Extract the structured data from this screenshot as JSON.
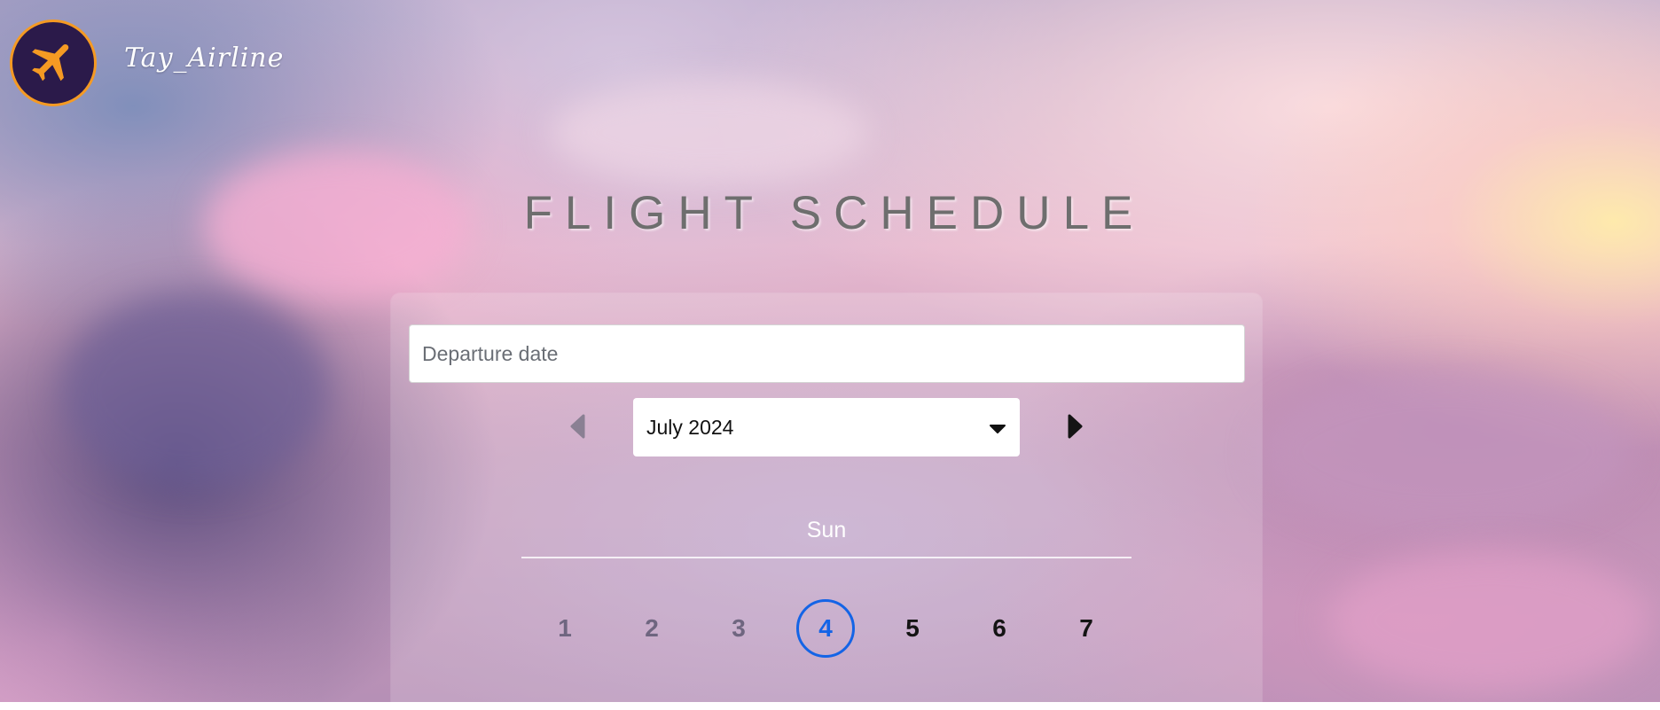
{
  "brand": {
    "name": "Tay_Airline",
    "logo_icon": "airplane-icon",
    "logo_bg": "#2b1a4a",
    "logo_ring": "#f59a23"
  },
  "page": {
    "title": "FLIGHT SCHEDULE"
  },
  "search": {
    "placeholder": "Departure date",
    "value": ""
  },
  "calendar": {
    "prev_icon": "triangle-left-icon",
    "next_icon": "triangle-right-icon",
    "month_label": "July 2024",
    "dropdown_icon": "caret-down-icon",
    "weekday": "Sun",
    "days": [
      {
        "label": "1",
        "state": "past"
      },
      {
        "label": "2",
        "state": "past"
      },
      {
        "label": "3",
        "state": "past"
      },
      {
        "label": "4",
        "state": "selected"
      },
      {
        "label": "5",
        "state": "future"
      },
      {
        "label": "6",
        "state": "future"
      },
      {
        "label": "7",
        "state": "future"
      }
    ],
    "selected_color": "#1464e6"
  }
}
